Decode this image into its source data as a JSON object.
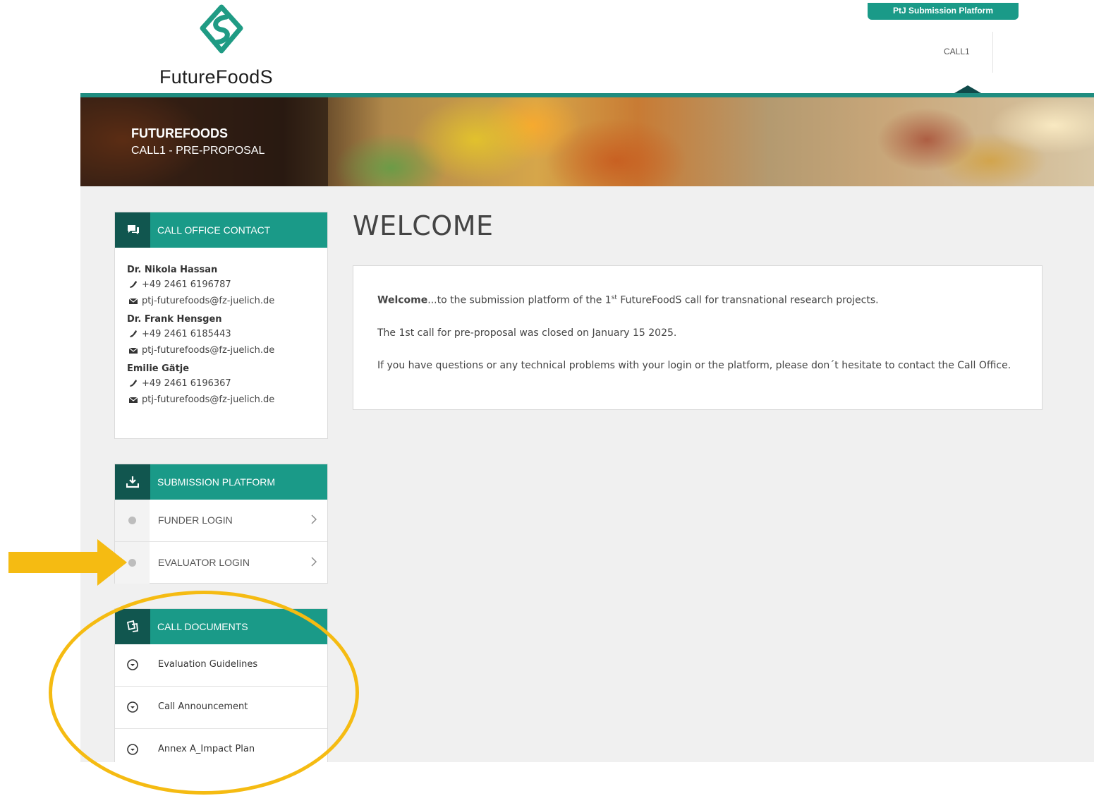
{
  "header": {
    "logo_text": "FutureFoodS",
    "platform_badge": "PtJ Submission Platform",
    "nav_call": "CALL1"
  },
  "banner": {
    "title": "FUTUREFOODS",
    "subtitle": "CALL1 - PRE-PROPOSAL"
  },
  "contact_panel": {
    "title": "CALL OFFICE CONTACT",
    "contacts": [
      {
        "name": "Dr. Nikola Hassan",
        "phone": "+49 2461 6196787",
        "email": "ptj-futurefoods@fz-juelich.de"
      },
      {
        "name": "Dr. Frank Hensgen",
        "phone": "+49 2461 6185443",
        "email": "ptj-futurefoods@fz-juelich.de"
      },
      {
        "name": "Emilie Gätje",
        "phone": "+49 2461 6196367",
        "email": "ptj-futurefoods@fz-juelich.de"
      }
    ]
  },
  "submission_panel": {
    "title": "SUBMISSION PLATFORM",
    "items": [
      {
        "label": "FUNDER LOGIN"
      },
      {
        "label": "EVALUATOR LOGIN"
      }
    ]
  },
  "documents_panel": {
    "title": "CALL DOCUMENTS",
    "items": [
      {
        "label": "Evaluation Guidelines"
      },
      {
        "label": "Call Announcement"
      },
      {
        "label": "Annex A_Impact Plan"
      }
    ]
  },
  "main": {
    "title": "WELCOME",
    "intro_bold": "Welcome",
    "intro_rest_a": "...to the submission platform of the 1",
    "intro_sup": "st",
    "intro_rest_b": " FutureFoodS call for transnational research projects.",
    "closed_text": "The 1st call for pre-proposal was closed on January 15 2025.",
    "help_text": "If you have questions or any technical problems with your login or the platform, please don´t hesitate to contact the Call Office."
  },
  "colors": {
    "teal": "#1a9a88",
    "teal_dark": "#11564f",
    "annotation_yellow": "#f5bb12"
  }
}
